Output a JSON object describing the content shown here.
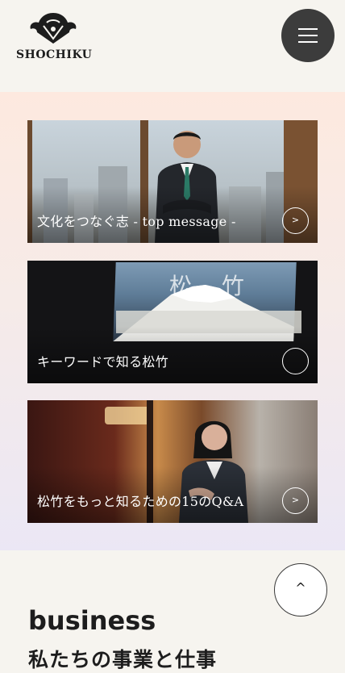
{
  "header": {
    "logo_text": "SHOCHIKU",
    "menu_icon": "hamburger-icon"
  },
  "cards": [
    {
      "title": "文化をつなぐ志 - top message -",
      "arrow": ">",
      "arrow_icon": "chevron-right-icon"
    },
    {
      "title": "キーワードで知る松竹",
      "arrow": "",
      "arrow_icon": "circle-icon"
    },
    {
      "title": "松竹をもっと知るための15のQ&A",
      "arrow": ">",
      "arrow_icon": "chevron-right-icon"
    }
  ],
  "card2_poster_text": "松 竹",
  "back_to_top": {
    "label": "^",
    "icon": "arrow-up-icon"
  },
  "section": {
    "en": "business",
    "ja": "私たちの事業と仕事"
  },
  "colors": {
    "menu_bg": "#3c3c3c",
    "page_bg": "#f6f4ef",
    "gradient_top": "#fde9df",
    "gradient_bottom": "#ebe7f5"
  }
}
